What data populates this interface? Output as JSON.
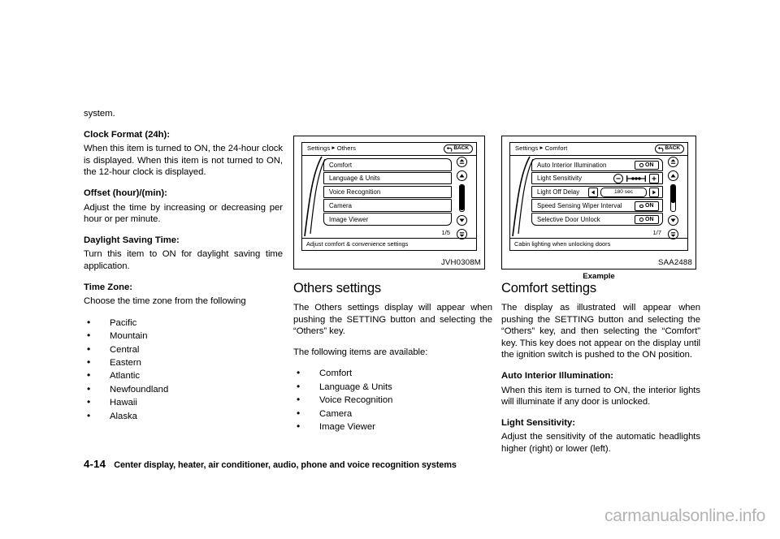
{
  "page": {
    "number": "4-14",
    "footer_title": "Center display, heater, air conditioner, audio, phone and voice recognition systems",
    "watermark": "carmanualsonline.info"
  },
  "column1": {
    "continuation": "system.",
    "sections": [
      {
        "heading": "Clock Format (24h):",
        "body": "When this item is turned to ON, the 24-hour clock is displayed. When this item is not turned to ON, the 12-hour clock is displayed."
      },
      {
        "heading": "Offset (hour)/(min):",
        "body": "Adjust the time by increasing or decreasing per hour or per minute."
      },
      {
        "heading": "Daylight Saving Time:",
        "body": "Turn this item to ON for daylight saving time application."
      },
      {
        "heading": "Time Zone:",
        "body": "Choose the time zone from the following"
      }
    ],
    "time_zones": [
      "Pacific",
      "Mountain",
      "Central",
      "Eastern",
      "Atlantic",
      "Newfoundland",
      "Hawaii",
      "Alaska"
    ]
  },
  "figure1": {
    "caption": "JVH0308M",
    "screen": {
      "breadcrumb_root": "Settings",
      "breadcrumb_leaf": "Others",
      "back_label": "BACK",
      "rows": [
        {
          "label": "Comfort"
        },
        {
          "label": "Language & Units"
        },
        {
          "label": "Voice Recognition"
        },
        {
          "label": "Camera"
        },
        {
          "label": "Image Viewer"
        }
      ],
      "page_indicator": "1/5",
      "status_bar": "Adjust comfort & convenience settings"
    }
  },
  "figure2": {
    "caption": "SAA2488",
    "example_label": "Example",
    "screen": {
      "breadcrumb_root": "Settings",
      "breadcrumb_leaf": "Comfort",
      "back_label": "BACK",
      "rows": [
        {
          "label": "Auto Interior Illumination",
          "control": "toggle",
          "value": "ON"
        },
        {
          "label": "Light Sensitivity",
          "control": "sensitivity"
        },
        {
          "label": "Light Off Delay",
          "control": "stepper",
          "value": "180 sec"
        },
        {
          "label": "Speed Sensing Wiper Interval",
          "control": "toggle",
          "value": "ON"
        },
        {
          "label": "Selective Door Unlock",
          "control": "toggle",
          "value": "ON"
        }
      ],
      "page_indicator": "1/7",
      "status_bar": "Cabin lighting when unlocking doors"
    }
  },
  "column2": {
    "title": "Others settings",
    "intro": "The Others settings display will appear when pushing the SETTING button and selecting the “Others” key.",
    "lead_in": "The following items are available:",
    "items": [
      "Comfort",
      "Language & Units",
      "Voice Recognition",
      "Camera",
      "Image Viewer"
    ]
  },
  "column3": {
    "title": "Comfort settings",
    "intro": "The display as illustrated will appear when pushing the SETTING button and selecting the “Others” key, and then selecting the “Comfort” key. This key does not appear on the display until the ignition switch is pushed to the ON position.",
    "sections": [
      {
        "heading": "Auto Interior Illumination:",
        "body": "When this item is turned to ON, the interior lights will illuminate if any door is unlocked."
      },
      {
        "heading": "Light Sensitivity:",
        "body": "Adjust the sensitivity of the automatic headlights higher (right) or lower (left)."
      }
    ]
  }
}
